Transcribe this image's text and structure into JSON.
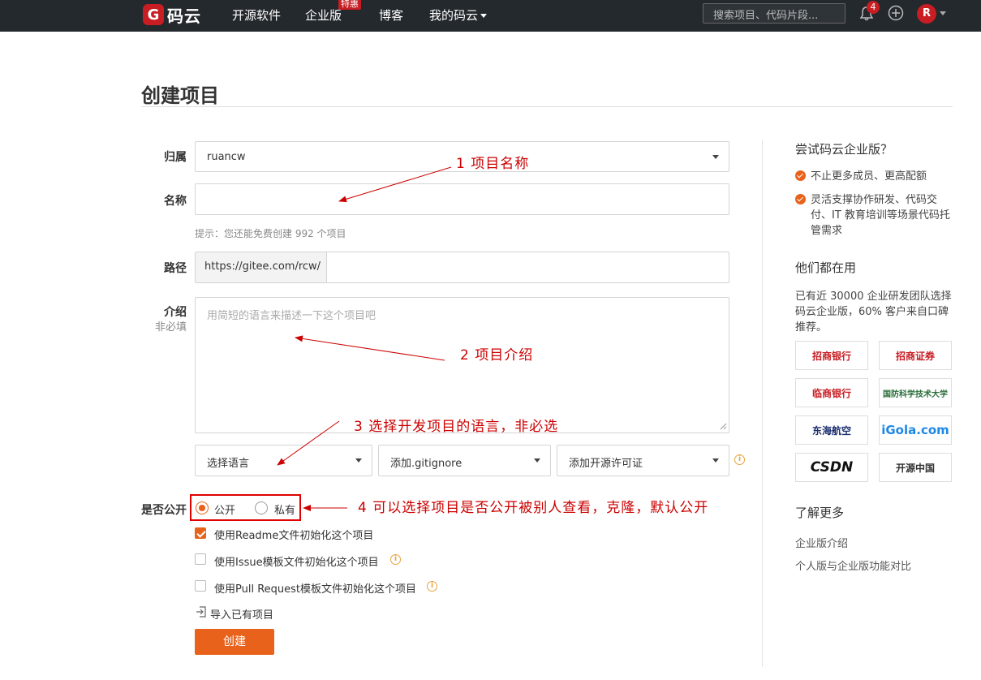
{
  "nav": {
    "logo_text": "码云",
    "logo_mark": "G",
    "items": [
      "开源软件",
      "企业版",
      "博客",
      "我的码云"
    ],
    "enterprise_badge": "特惠",
    "search_placeholder": "搜索项目、代码片段...",
    "notif_count": "4",
    "avatar_letter": "R"
  },
  "page": {
    "title": "创建项目"
  },
  "form": {
    "owner": {
      "label": "归属",
      "value": "ruancw"
    },
    "name": {
      "label": "名称",
      "value": ""
    },
    "hint": "提示：您还能免费创建 992 个项目",
    "path": {
      "label": "路径",
      "prefix": "https://gitee.com/rcw/",
      "value": ""
    },
    "intro": {
      "label": "介绍",
      "sub": "非必填",
      "placeholder": "用简短的语言来描述一下这个项目吧"
    },
    "language_select": "选择语言",
    "gitignore_select": "添加.gitignore",
    "license_select": "添加开源许可证",
    "visibility": {
      "label": "是否公开",
      "options": [
        "公开",
        "私有"
      ],
      "selected": "公开"
    },
    "checkboxes": [
      {
        "label": "使用Readme文件初始化这个项目",
        "checked": true
      },
      {
        "label": "使用Issue模板文件初始化这个项目",
        "checked": false
      },
      {
        "label": "使用Pull Request模板文件初始化这个项目",
        "checked": false
      }
    ],
    "import_link": "导入已有项目",
    "submit": "创建"
  },
  "annotations": {
    "a1": "1 项目名称",
    "a2": "2 项目介绍",
    "a3": "3 选择开发项目的语言，非必选",
    "a4": "4 可以选择项目是否公开被别人查看，克隆，默认公开"
  },
  "sidebar": {
    "heading": "尝试码云企业版？",
    "features": [
      "不止更多成员、更高配额",
      "灵活支撑协作研发、代码交付、IT 教育培训等场景代码托管需求"
    ],
    "users_heading": "他们都在用",
    "users_text": "已有近 30000 企业研发团队选择码云企业版，60% 客户来自口碑推荐。",
    "logos": [
      "招商银行",
      "招商证券",
      "临商银行",
      "国防科学技术大学",
      "东海航空",
      "iGola.com",
      "CSDN",
      "开源中国"
    ],
    "more_heading": "了解更多",
    "links": [
      "企业版介绍",
      "个人版与企业版功能对比"
    ]
  },
  "colors": {
    "accent": "#e8621c",
    "nav_bg": "#24292e",
    "annotation": "#cc0000"
  }
}
